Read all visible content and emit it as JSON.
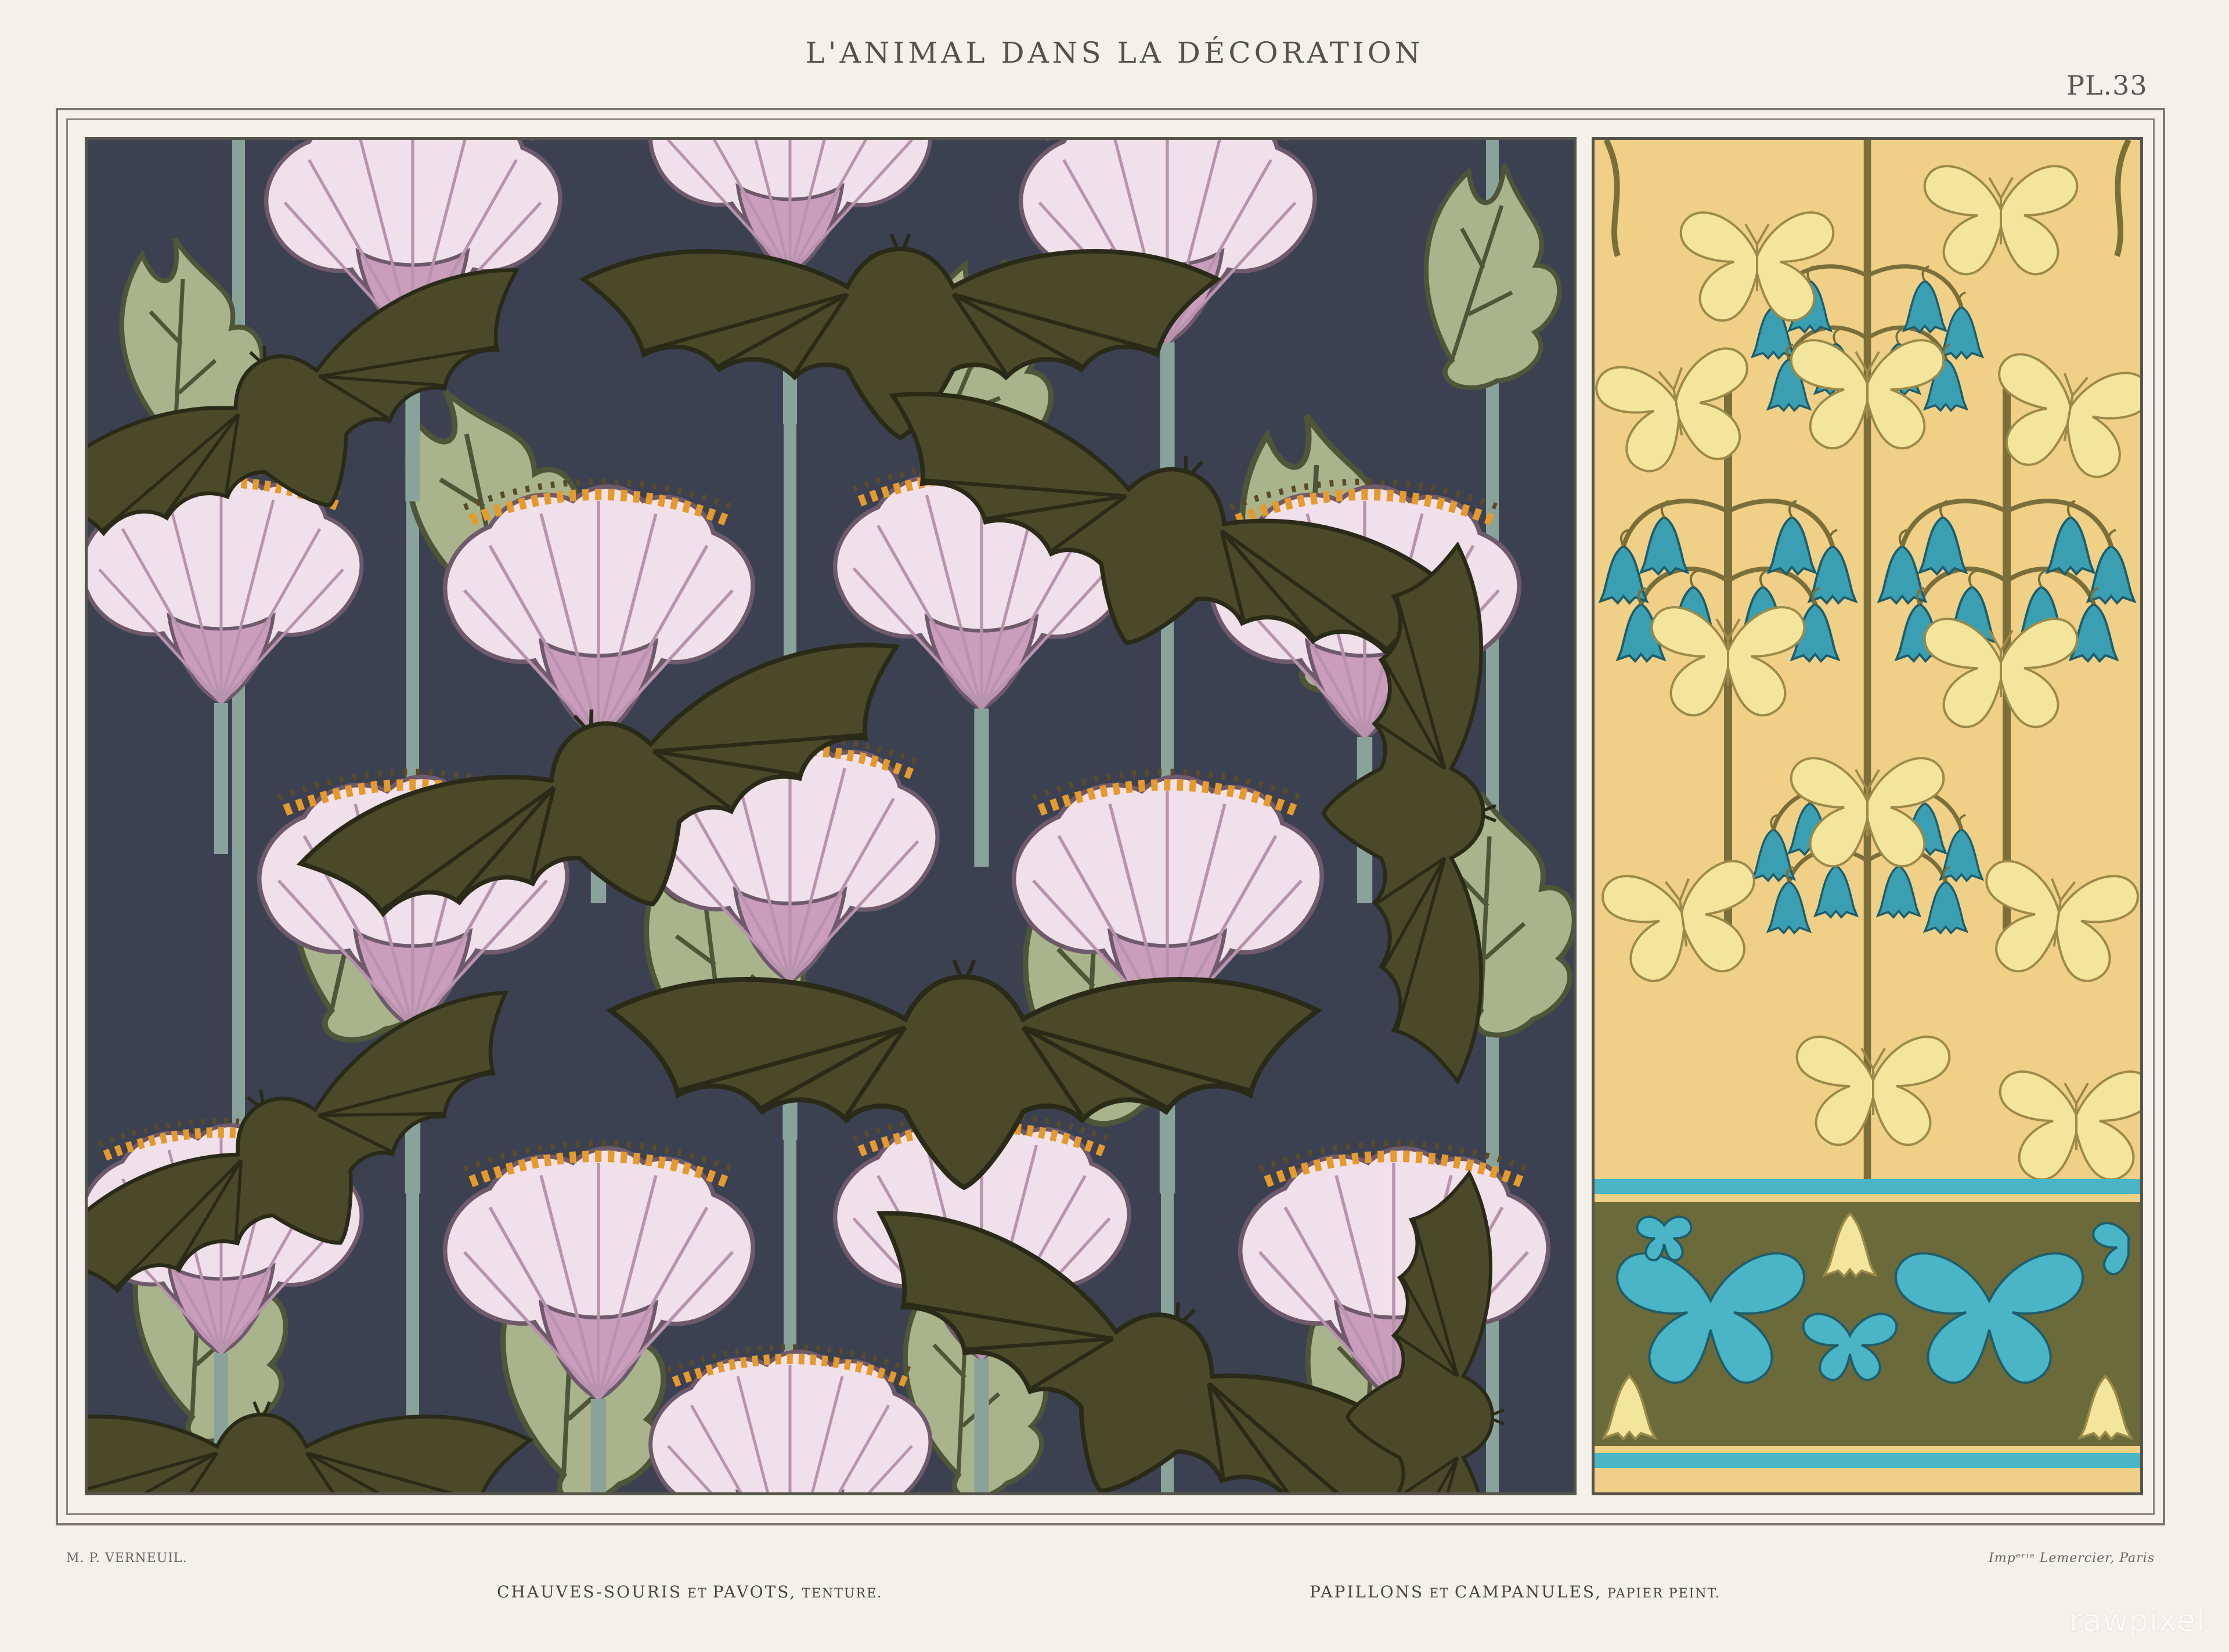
{
  "header": {
    "title": "L'ANIMAL DANS LA DÉCORATION",
    "plate_number": "PL.33"
  },
  "footer": {
    "artist": "M. P. VERNEUIL.",
    "printer": "Impᵉʳⁱᵉ Lemercier, Paris",
    "caption_left": {
      "main": "CHAUVES-SOURIS",
      "joiner": " ET ",
      "second": "PAVOTS,",
      "kind": " TENTURE."
    },
    "caption_right": {
      "main": "PAPILLONS",
      "joiner": " ET ",
      "second": "CAMPANULES,",
      "kind": " PAPIER PEINT."
    }
  },
  "watermark": "rawpixel",
  "illustrations": {
    "left": {
      "subject": "bats-and-poppies-pattern-icon",
      "colors": {
        "background": "#3c4152",
        "petal": "#d9b8cf",
        "petal_light": "#efe0ea",
        "leaf": "#a9b48c",
        "bat": "#4a4a2a",
        "stamen": "#e59a2b"
      }
    },
    "right": {
      "subject": "butterflies-and-bellflowers-pattern-icon",
      "colors": {
        "background": "#f0cf86",
        "butterfly": "#f4e59c",
        "bell": "#3a9fb3",
        "stem": "#7a6f3a",
        "border_band": "#6b6a3a",
        "border_butterfly": "#49b5c6"
      }
    }
  }
}
